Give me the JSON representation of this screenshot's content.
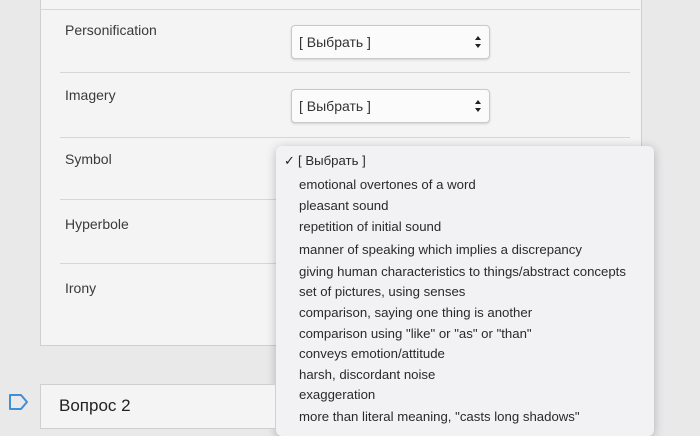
{
  "matching": {
    "rows": [
      {
        "term": "Personification",
        "selected": "[ Выбрать ]"
      },
      {
        "term": "Imagery",
        "selected": "[ Выбрать ]"
      },
      {
        "term": "Symbol"
      },
      {
        "term": "Hyperbole"
      },
      {
        "term": "Irony"
      }
    ]
  },
  "dropdown": {
    "checked_label": "[ Выбрать ]",
    "options": [
      "emotional overtones of a word",
      "pleasant sound",
      "repetition of initial sound",
      "manner of speaking which implies a discrepancy",
      "giving human characteristics to things/abstract concepts",
      "set of pictures, using senses",
      "comparison, saying one thing is another",
      "comparison using \"like\" or \"as\" or \"than\"",
      "conveys emotion/attitude",
      "harsh, discordant noise",
      "exaggeration",
      "more than literal meaning, \"casts long shadows\""
    ]
  },
  "question": {
    "title": "Вопрос 2"
  },
  "colors": {
    "accent": "#3f8ed8",
    "background": "#e9e9ea"
  }
}
